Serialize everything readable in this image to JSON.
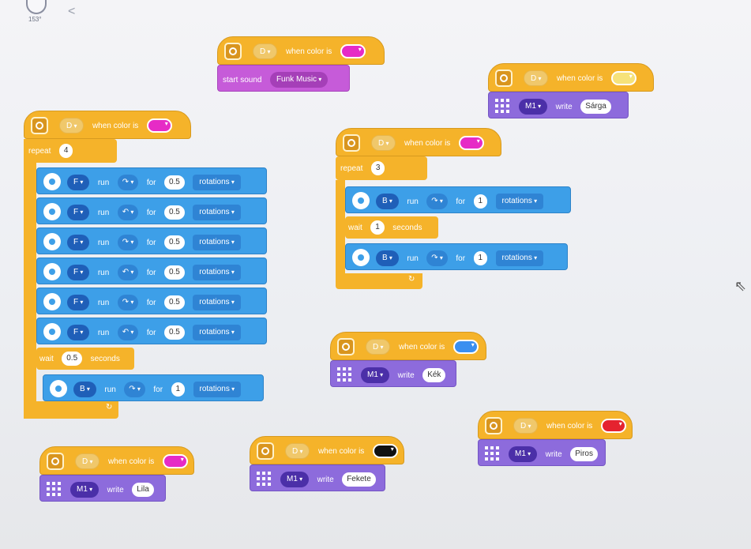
{
  "top": {
    "robot_label": "153°",
    "back_glyph": "<"
  },
  "colors": {
    "magenta": "#e62bc6",
    "yellow": "#f6e27a",
    "blue": "#3a8ff0",
    "black": "#111111",
    "red": "#e5232f"
  },
  "labels": {
    "when_color_is": "when color is",
    "repeat": "repeat",
    "run": "run",
    "for": "for",
    "rotations": "rotations",
    "wait": "wait",
    "seconds": "seconds",
    "write": "write",
    "start_sound": "start sound"
  },
  "stacks": {
    "sound": {
      "port": "D",
      "sound_name": "Funk Music"
    },
    "sarga": {
      "port": "D",
      "display": "M1",
      "text": "Sárga"
    },
    "main": {
      "port": "D",
      "repeat": "4",
      "motors": [
        {
          "port": "F",
          "dir": "↷",
          "amount": "0.5"
        },
        {
          "port": "F",
          "dir": "↶",
          "amount": "0.5"
        },
        {
          "port": "F",
          "dir": "↷",
          "amount": "0.5"
        },
        {
          "port": "F",
          "dir": "↶",
          "amount": "0.5"
        },
        {
          "port": "F",
          "dir": "↷",
          "amount": "0.5"
        },
        {
          "port": "F",
          "dir": "↶",
          "amount": "0.5"
        }
      ],
      "wait": "0.5",
      "after": {
        "port": "B",
        "dir": "↷",
        "amount": "1"
      }
    },
    "middle": {
      "port": "D",
      "repeat": "3",
      "m1": {
        "port": "B",
        "dir": "↷",
        "amount": "1"
      },
      "wait": "1",
      "m2": {
        "port": "B",
        "dir": "↷",
        "amount": "1"
      }
    },
    "kek": {
      "port": "D",
      "display": "M1",
      "text": "Kék"
    },
    "piros": {
      "port": "D",
      "display": "M1",
      "text": "Piros"
    },
    "lila": {
      "port": "D",
      "display": "M1",
      "text": "Lila"
    },
    "fekete": {
      "port": "D",
      "display": "M1",
      "text": "Fekete"
    }
  }
}
